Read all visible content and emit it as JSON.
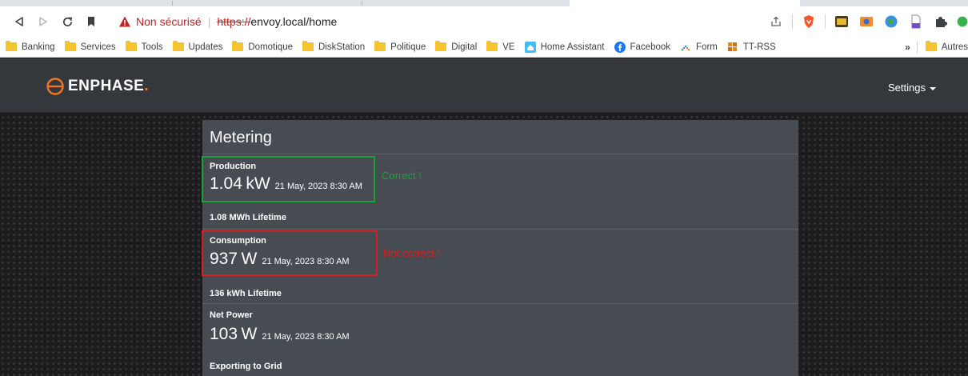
{
  "browser": {
    "security_label": "Non sécurisé",
    "url_scheme": "https://",
    "url_host": "envoy.local/home",
    "bookmarks": [
      {
        "label": "Banking",
        "icon": "folder-icon"
      },
      {
        "label": "Services",
        "icon": "folder-icon"
      },
      {
        "label": "Tools",
        "icon": "folder-icon"
      },
      {
        "label": "Updates",
        "icon": "folder-icon"
      },
      {
        "label": "Domotique",
        "icon": "folder-icon"
      },
      {
        "label": "DiskStation",
        "icon": "folder-icon"
      },
      {
        "label": "Politique",
        "icon": "folder-icon"
      },
      {
        "label": "Digital",
        "icon": "folder-icon"
      },
      {
        "label": "VE",
        "icon": "folder-icon"
      },
      {
        "label": "Home Assistant",
        "icon": "home-assistant-icon"
      },
      {
        "label": "Facebook",
        "icon": "facebook-icon"
      },
      {
        "label": "Form",
        "icon": "form-icon"
      },
      {
        "label": "TT-RSS",
        "icon": "rss-icon"
      }
    ],
    "bookmarks_more": "»",
    "bookmarks_other": "Autres"
  },
  "app": {
    "brand": "ENPHASE",
    "brand_dot": ".",
    "settings_label": "Settings",
    "accent_color": "#f37321"
  },
  "metering": {
    "title": "Metering",
    "production": {
      "label": "Production",
      "value": "1.04",
      "unit": "kW",
      "timestamp": "21 May, 2023 8:30 AM",
      "lifetime": "1.08 MWh  Lifetime"
    },
    "consumption": {
      "label": "Consumption",
      "value": "937",
      "unit": "W",
      "timestamp": "21 May, 2023 8:30 AM",
      "lifetime": "136 kWh  Lifetime"
    },
    "net_power": {
      "label": "Net Power",
      "value": "103",
      "unit": "W",
      "timestamp": "21 May, 2023 8:30 AM",
      "status": "Exporting to Grid"
    }
  },
  "annotations": {
    "correct": {
      "text": "Correct !",
      "color": "#1aa13a"
    },
    "not_correct": {
      "text": "Not correct !",
      "color": "#d42020"
    }
  }
}
